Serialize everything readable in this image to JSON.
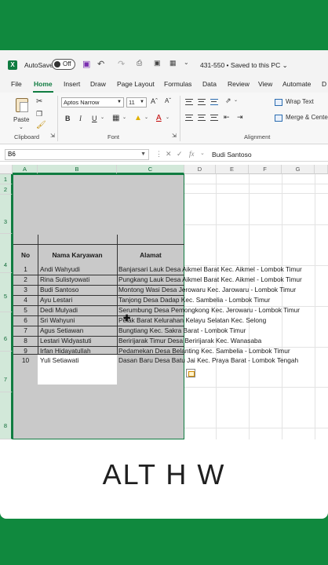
{
  "titlebar": {
    "logo": "X",
    "autosave_label": "AutoSave",
    "autosave_state": "Off",
    "doc_title": "431-550 • Saved to this PC ⌄"
  },
  "tabs": [
    "File",
    "Home",
    "Insert",
    "Draw",
    "Page Layout",
    "Formulas",
    "Data",
    "Review",
    "View",
    "Automate",
    "D"
  ],
  "ribbon": {
    "paste_label": "Paste",
    "clipboard_label": "Clipboard",
    "font_name": "Aptos Narrow",
    "font_size": "11",
    "bold": "B",
    "italic": "I",
    "underline": "U",
    "font_label": "Font",
    "wrap_text": "Wrap Text",
    "merge_center": "Merge & Center",
    "alignment_label": "Alignment"
  },
  "formula": {
    "namebox": "B6",
    "fx": "fx",
    "value": "Budi Santoso"
  },
  "columns": [
    "A",
    "B",
    "C",
    "D",
    "E",
    "F",
    "G"
  ],
  "rows": [
    "1",
    "2",
    "3",
    "4",
    "5",
    "6",
    "7",
    "8"
  ],
  "table": {
    "headers": [
      "No",
      "Nama Karyawan",
      "Alamat"
    ],
    "rows": [
      {
        "no": "1",
        "nama": "Andi Wahyudi",
        "alamat": "Banjarsari Lauk Desa Aikmel Barat Kec. Aikmel - Lombok Timur"
      },
      {
        "no": "2",
        "nama": "Rina Sulistyowati",
        "alamat": "Pungkang Lauk Desa Aikmel Barat Kec. Aikmel - Lombok Timur"
      },
      {
        "no": "3",
        "nama": "Budi Santoso",
        "alamat": "Montong Wasi Desa Jerowaru Kec. Jarowaru - Lombok Timur"
      },
      {
        "no": "4",
        "nama": "Ayu Lestari",
        "alamat": "Tanjong Desa Dadap Kec. Sambelia - Lombok Timur"
      },
      {
        "no": "5",
        "nama": "Dedi Mulyadi",
        "alamat": "Serumbung Desa Pemongkong Kec. Jerowaru - Lombok Timur"
      },
      {
        "no": "6",
        "nama": "Sri Wahyuni",
        "alamat": "Pelak Barat Kelurahan Kelayu Selatan Kec. Selong"
      },
      {
        "no": "7",
        "nama": "Agus Setiawan",
        "alamat": "Bungtiang Kec. Sakra Barat - Lombok Timur"
      },
      {
        "no": "8",
        "nama": "Lestari Widyastuti",
        "alamat": "Beririjarak Timur Desa Beririjarak Kec. Wanasaba"
      },
      {
        "no": "9",
        "nama": "Irfan Hidayatullah",
        "alamat": "Pedamekan Desa Belanting Kec. Sambelia - Lombok Timur"
      },
      {
        "no": "10",
        "nama": "Yuli Setiawati",
        "alamat": "Dasan Baru Desa Batu Jai Kec. Praya Barat - Lombok Tengah"
      }
    ]
  },
  "caption": "ALT H W",
  "colors": {
    "background": "#10893e",
    "accent": "#107c41",
    "selection": "#c9c9c9"
  }
}
